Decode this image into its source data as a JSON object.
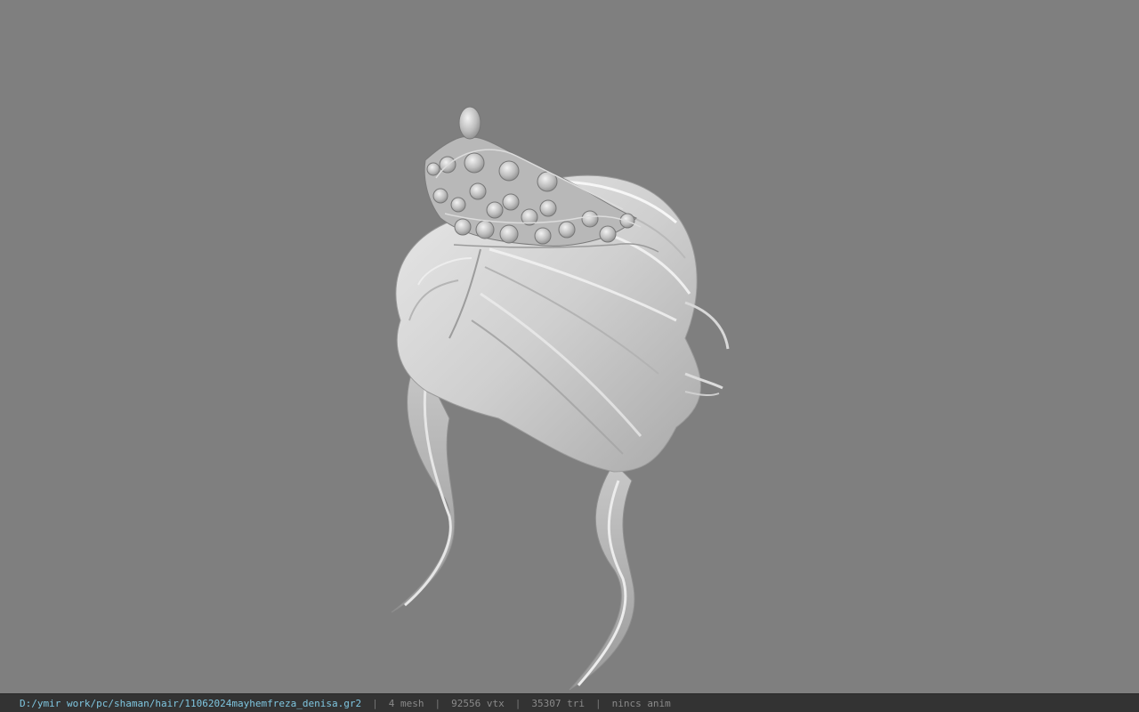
{
  "viewer": {
    "background_color": "#7f7f7f",
    "model_icon": "hair-with-tiara-model"
  },
  "status_bar": {
    "file_path": "D:/ymir work/pc/shaman/hair/11062024mayhemfreza_denisa.gr2",
    "separator": "|",
    "mesh_count": "4 mesh",
    "vertex_count": "92556 vtx",
    "triangle_count": "35307 tri",
    "animation": "nincs anim",
    "path_color": "#7fc6e0",
    "text_color": "#8a8a8a",
    "bar_color": "#333333"
  }
}
